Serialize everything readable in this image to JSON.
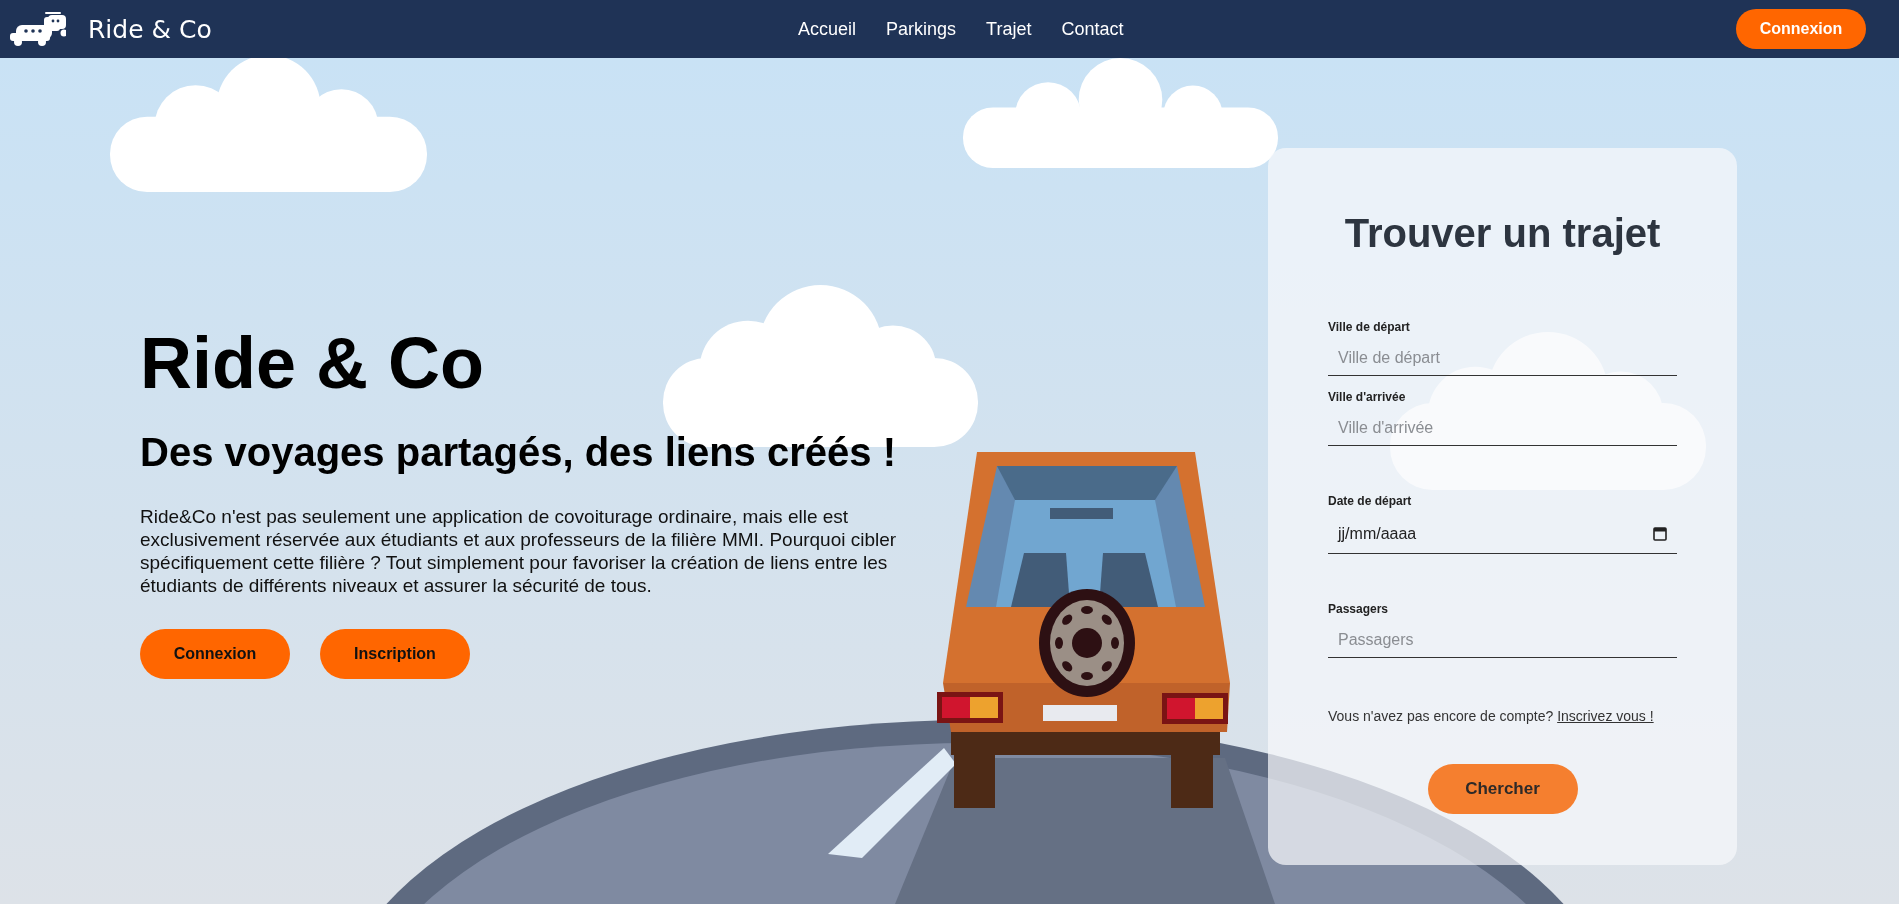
{
  "navbar": {
    "brand": "Ride & Co",
    "links": [
      "Accueil",
      "Parkings",
      "Trajet",
      "Contact"
    ],
    "login_button": "Connexion"
  },
  "hero": {
    "title": "Ride & Co",
    "subtitle": "Des voyages partagés, des liens créés !",
    "description": "Ride&Co n'est pas seulement une application de covoiturage ordinaire, mais elle est exclusivement réservée aux étudiants et aux professeurs de la filière MMI. Pourquoi cibler spécifiquement cette filière ? Tout simplement pour favoriser la création de liens entre les étudiants de différents niveaux et assurer la sécurité de tous.",
    "buttons": [
      "Connexion",
      "Inscription"
    ]
  },
  "search_form": {
    "title": "Trouver un trajet",
    "fields": [
      {
        "kind": "text",
        "label": "Ville de départ",
        "placeholder": "Ville de départ"
      },
      {
        "kind": "text",
        "label": "Ville d'arrivée",
        "placeholder": "Ville d'arrivée"
      },
      {
        "kind": "date",
        "label": "Date de départ",
        "placeholder": "jj/mm/aaaa"
      },
      {
        "kind": "text",
        "label": "Passagers",
        "placeholder": "Passagers"
      }
    ],
    "signup_prompt": "Vous n'avez pas encore de compte?",
    "signup_link": "Inscrivez vous !",
    "submit_button": "Chercher"
  }
}
